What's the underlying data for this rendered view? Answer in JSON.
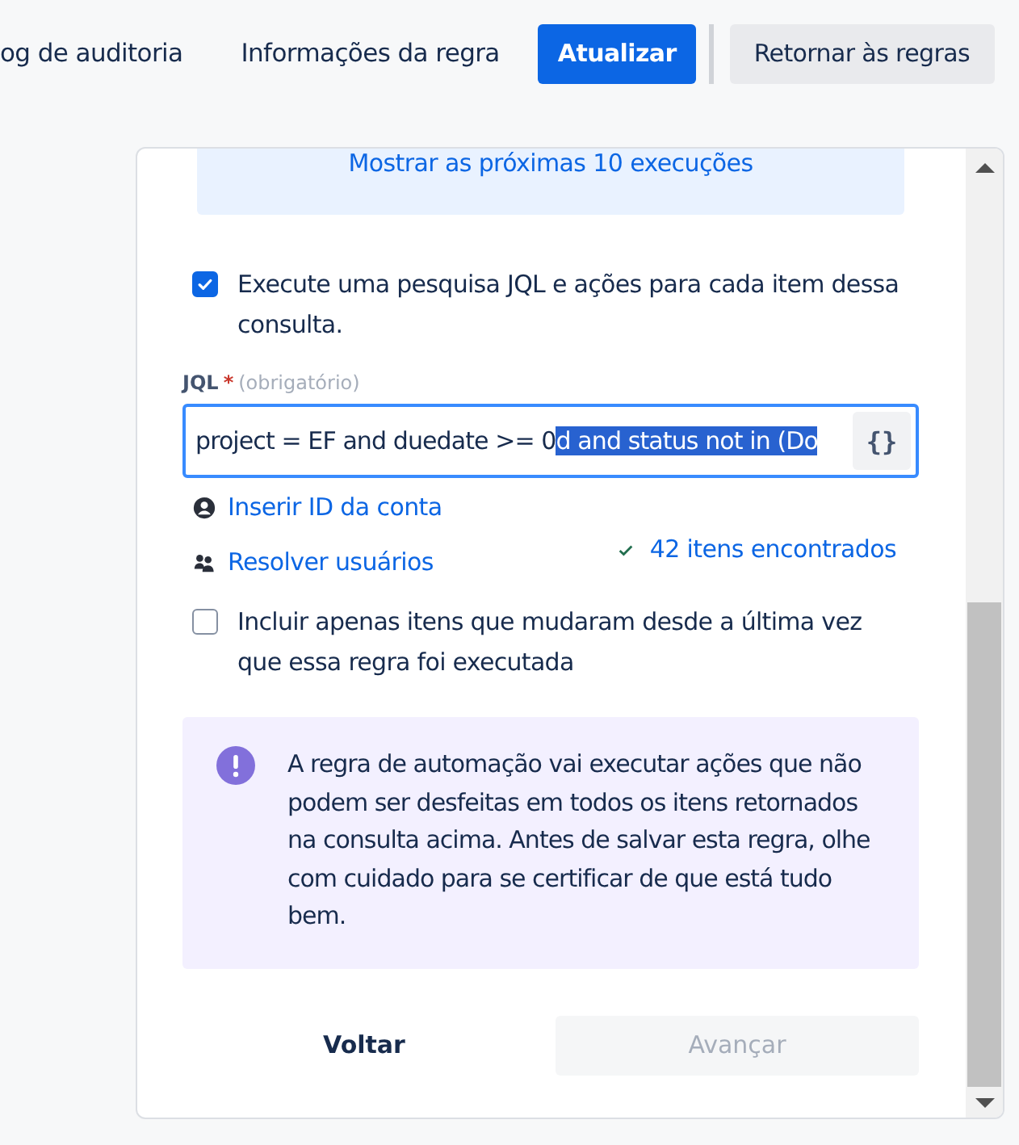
{
  "top_nav": {
    "links": [
      {
        "label": "og de auditoria"
      },
      {
        "label": "Informações da regra"
      }
    ],
    "buttons": [
      {
        "label": "Atualizar",
        "kind": "primary"
      },
      {
        "label": "Retornar às regras",
        "kind": "secondary"
      }
    ]
  },
  "panel": {
    "schedule_link": "Mostrar as próximas 10 execuções",
    "run_jql": {
      "checked": true,
      "label": "Execute uma pesquisa JQL e ações para cada item dessa consulta."
    },
    "jql": {
      "label": "JQL",
      "required_mark": "*",
      "hint": "(obrigatório)",
      "value": "project = EF and duedate >= 0",
      "selected_text": "d and status not in (Do",
      "button": "{}"
    },
    "links": [
      {
        "label": "Inserir ID da conta",
        "kind": "person"
      },
      {
        "label": "Resolver usuários",
        "kind": "people"
      }
    ],
    "result": "42 itens encontrados",
    "only_changed": {
      "checked": false,
      "label": "Incluir apenas itens que mudaram desde a última vez que essa regra foi executada"
    },
    "warning": "A regra de automação vai executar ações que não podem ser desfeitas em todos os itens retornados na consulta acima. Antes de salvar esta regra, olhe com cuidado para se certificar de que está tudo bem.",
    "footer": [
      {
        "label": "Voltar",
        "disabled": false
      },
      {
        "label": "Avançar",
        "disabled": true
      }
    ]
  }
}
